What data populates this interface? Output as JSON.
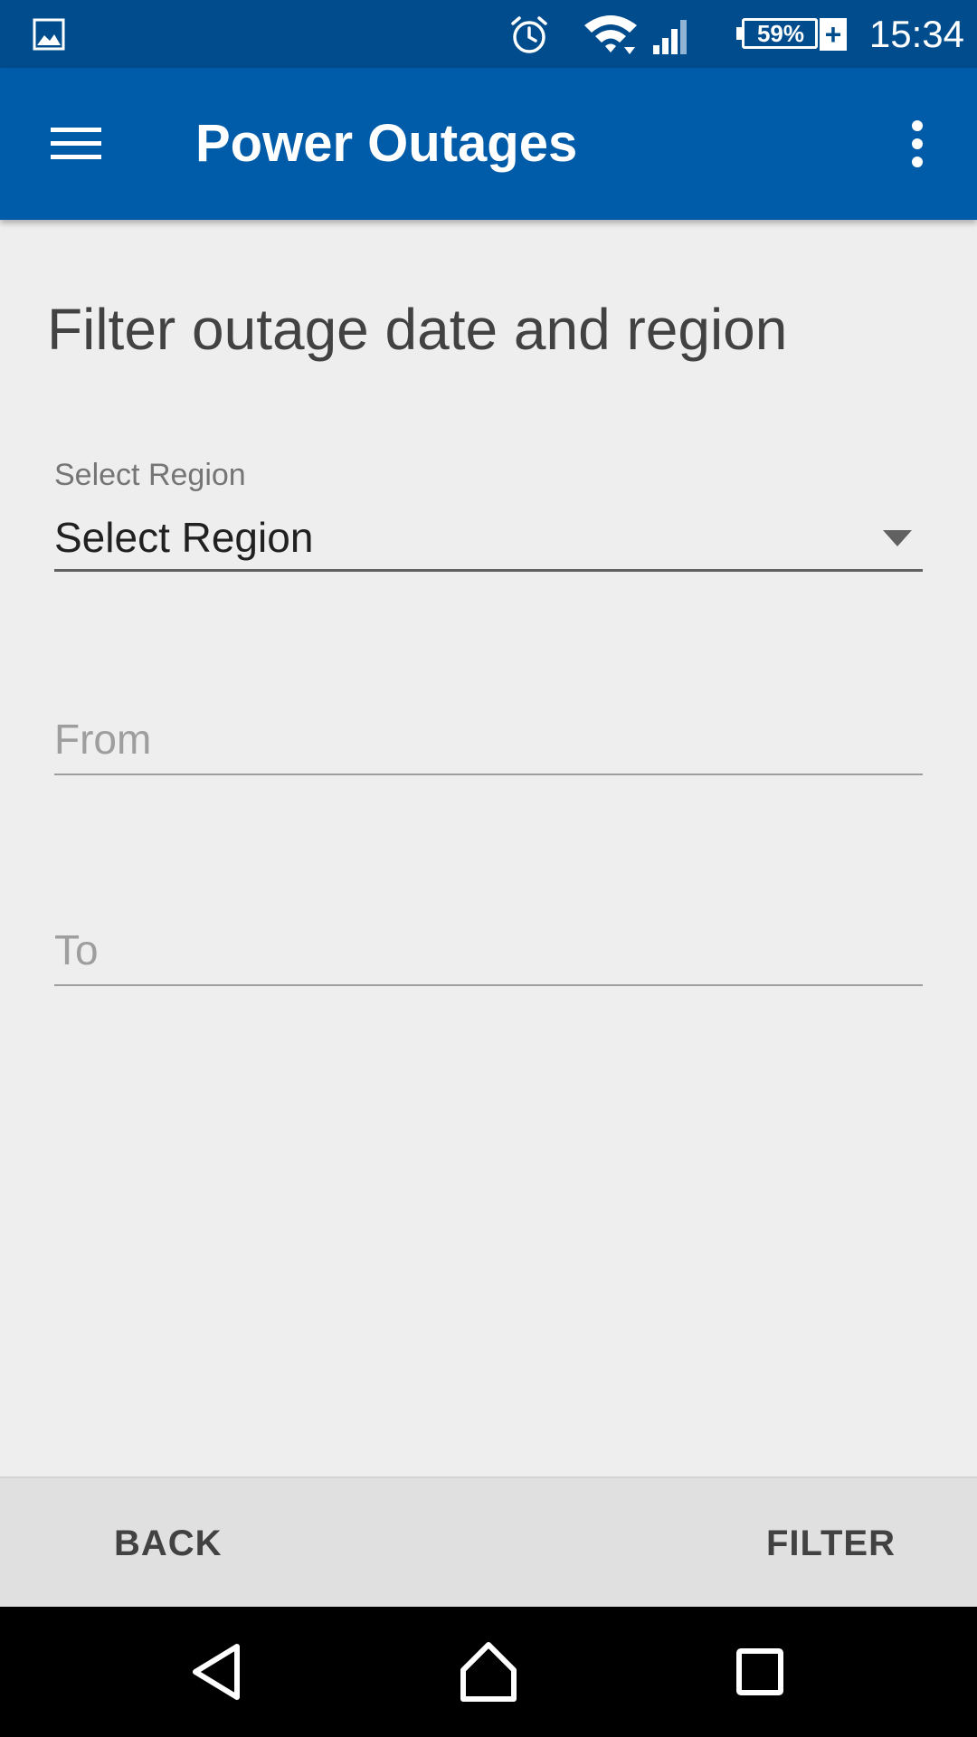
{
  "status_bar": {
    "battery_percent": "59%",
    "battery_charging_symbol": "+",
    "time": "15:34",
    "icons": [
      "gallery-icon",
      "alarm-icon",
      "wifi-icon",
      "cell-signal-icon",
      "battery-icon"
    ]
  },
  "app_bar": {
    "title": "Power Outages",
    "menu_icon": "hamburger-menu-icon",
    "overflow_icon": "more-vert-icon"
  },
  "form": {
    "heading": "Filter outage date and region",
    "region": {
      "caption": "Select Region",
      "selected_value": "Select Region"
    },
    "from": {
      "placeholder": "From",
      "value": ""
    },
    "to": {
      "placeholder": "To",
      "value": ""
    }
  },
  "actions": {
    "back_label": "BACK",
    "filter_label": "FILTER"
  },
  "nav_bar": {
    "icons": [
      "nav-back-icon",
      "nav-home-icon",
      "nav-recents-icon"
    ]
  },
  "colors": {
    "status_bar_bg": "#004c8d",
    "app_bar_bg": "#005ca8",
    "page_bg": "#eeeeee",
    "action_bar_bg": "#e0e0e0"
  }
}
